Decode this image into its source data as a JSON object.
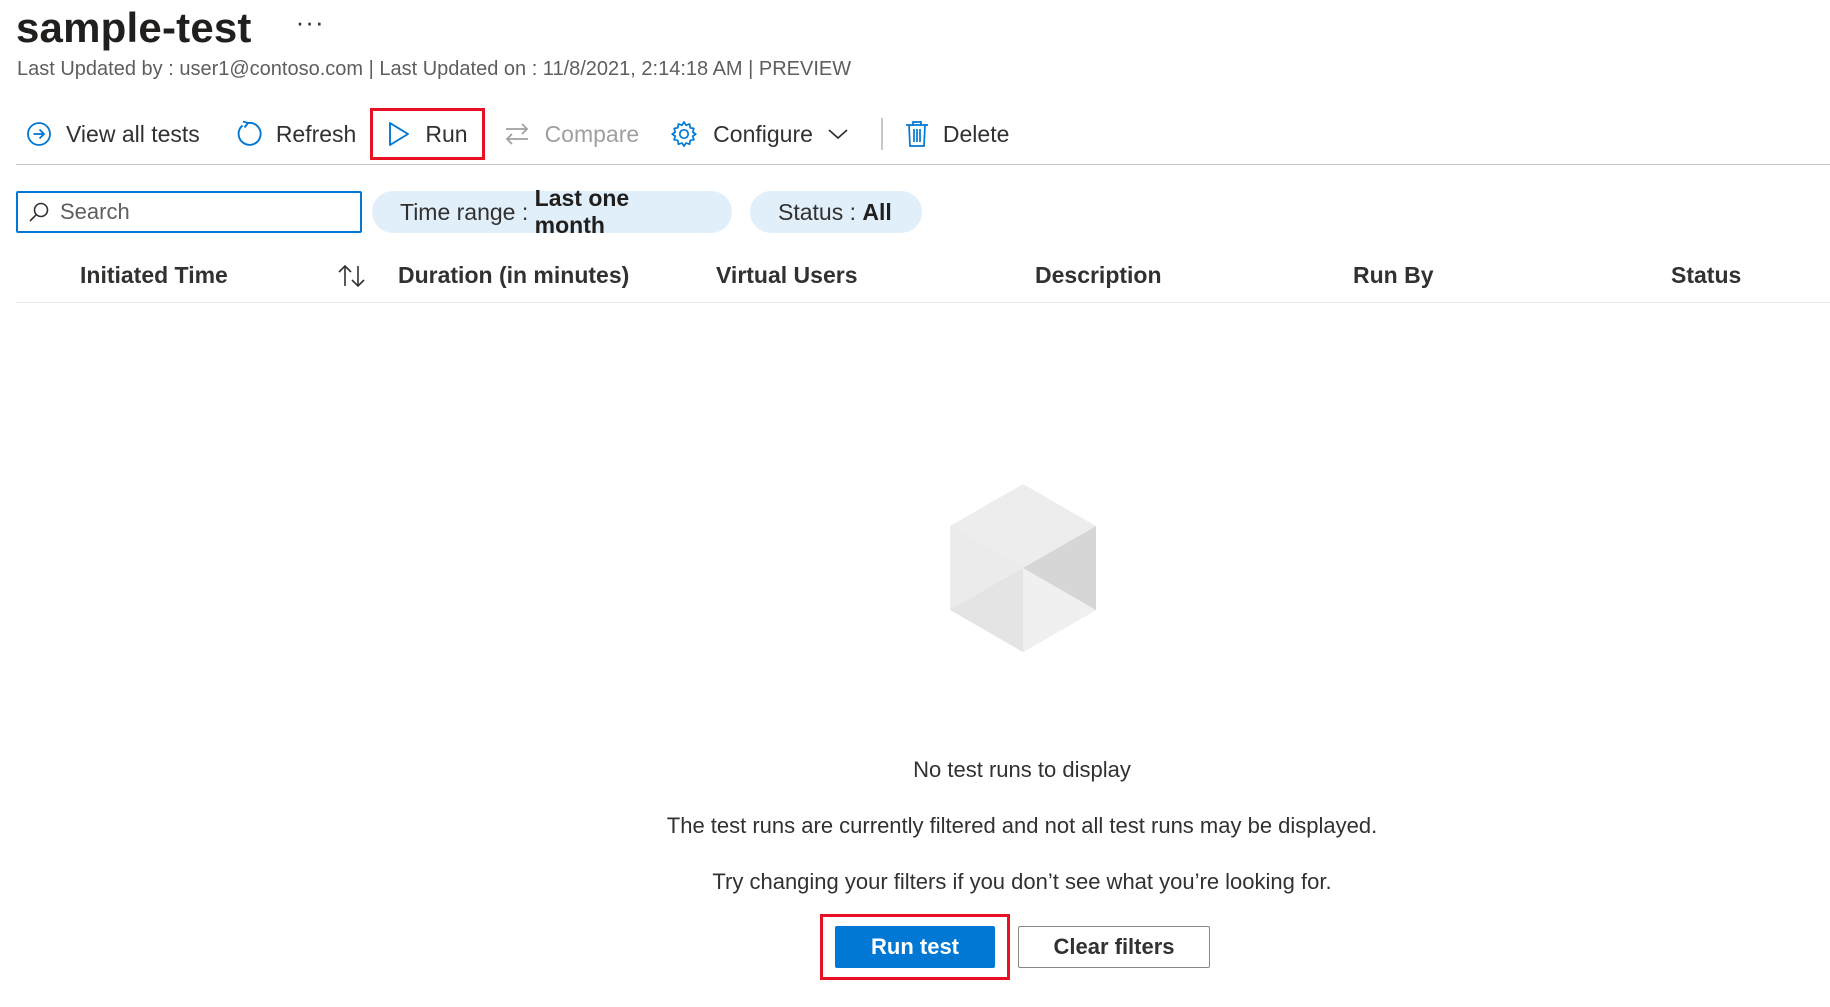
{
  "header": {
    "title": "sample-test",
    "more": "···",
    "subtitle": "Last Updated by : user1@contoso.com | Last Updated on : 11/8/2021, 2:14:18 AM | PREVIEW"
  },
  "toolbar": {
    "view_all": "View all tests",
    "refresh": "Refresh",
    "run": "Run",
    "compare": "Compare",
    "configure": "Configure",
    "delete": "Delete"
  },
  "filters": {
    "search_placeholder": "Search",
    "time_range_label": "Time range : ",
    "time_range_value": "Last one month",
    "status_label": "Status : ",
    "status_value": "All"
  },
  "table": {
    "columns": [
      "Initiated Time",
      "Duration (in minutes)",
      "Virtual Users",
      "Description",
      "Run By",
      "Status"
    ]
  },
  "empty_state": {
    "title": "No test runs to display",
    "line1": "The test runs are currently filtered and not all test runs may be displayed.",
    "line2": "Try changing your filters if you don’t see what you’re looking for.",
    "run_test": "Run test",
    "clear_filters": "Clear filters"
  },
  "colors": {
    "accent": "#0078d4",
    "highlight": "#e81123",
    "pill_bg": "#e1effa"
  }
}
